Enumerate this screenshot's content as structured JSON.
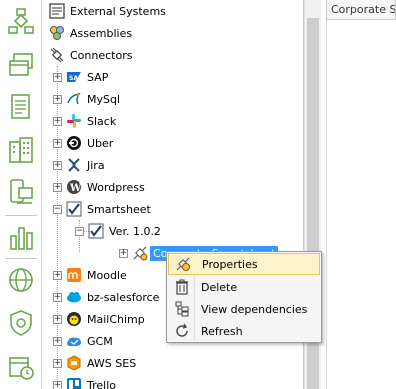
{
  "iconbar": {
    "items": [
      {
        "icon": "workflow-icon"
      },
      {
        "icon": "windows-icon"
      },
      {
        "icon": "document-icon"
      },
      {
        "icon": "building-icon"
      },
      {
        "icon": "devices-icon"
      },
      {
        "icon": "bar-chart-icon"
      },
      {
        "icon": "globe-icon"
      },
      {
        "icon": "shield-gear-icon"
      },
      {
        "icon": "calendar-clock-icon"
      }
    ]
  },
  "tree": {
    "items": [
      {
        "label": "External Systems",
        "icon": "external-systems-icon"
      },
      {
        "label": "Assemblies",
        "icon": "assemblies-icon"
      },
      {
        "label": "Connectors",
        "icon": "connectors-icon"
      },
      {
        "label": "SAP",
        "icon": "sap-icon"
      },
      {
        "label": "MySql",
        "icon": "mysql-icon"
      },
      {
        "label": "Slack",
        "icon": "slack-icon"
      },
      {
        "label": "Uber",
        "icon": "uber-icon"
      },
      {
        "label": "Jira",
        "icon": "jira-icon"
      },
      {
        "label": "Wordpress",
        "icon": "wordpress-icon"
      },
      {
        "label": "Smartsheet",
        "icon": "smartsheet-icon"
      },
      {
        "label": "Ver. 1.0.2",
        "icon": "version-icon"
      },
      {
        "label": "Corporate Smartsheet",
        "icon": "connection-icon"
      },
      {
        "label": "Moodle",
        "icon": "moodle-icon"
      },
      {
        "label": "bz-salesforce",
        "icon": "salesforce-icon"
      },
      {
        "label": "MailChimp",
        "icon": "mailchimp-icon"
      },
      {
        "label": "GCM",
        "icon": "gcm-icon"
      },
      {
        "label": "AWS SES",
        "icon": "aws-ses-icon"
      },
      {
        "label": "Trello",
        "icon": "trello-icon"
      }
    ]
  },
  "right_pane": {
    "tab_label": "Corporate Smartsheet"
  },
  "context_menu": {
    "items": [
      {
        "label": "Properties",
        "icon": "properties-icon",
        "highlighted": true
      },
      {
        "label": "Delete",
        "icon": "trash-icon"
      },
      {
        "label": "View dependencies",
        "icon": "dependencies-icon"
      },
      {
        "label": "Refresh",
        "icon": "refresh-icon"
      }
    ]
  },
  "colors": {
    "selection": "#3399ff",
    "menu_highlight": "#fdf3cb",
    "icon_green": "#6aa84f"
  }
}
